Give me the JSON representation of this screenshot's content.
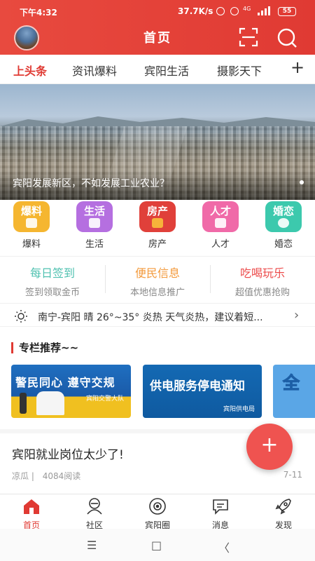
{
  "status": {
    "time": "下午4:32",
    "speed": "37.7K/s",
    "network": "4G",
    "battery": "55"
  },
  "header": {
    "title": "首页"
  },
  "tabs": [
    "上头条",
    "资讯爆料",
    "宾阳生活",
    "摄影天下"
  ],
  "tabs_more": "+",
  "banner": {
    "caption": "宾阳发展新区，不如发展工业农业？"
  },
  "categories": [
    {
      "tile": "爆料",
      "label": "爆料",
      "color": "#f5b630"
    },
    {
      "tile": "生活",
      "label": "生活",
      "color": "#b56fe0"
    },
    {
      "tile": "房产",
      "label": "房产",
      "color": "#e0403a"
    },
    {
      "tile": "人才",
      "label": "人才",
      "color": "#f06aa8"
    },
    {
      "tile": "婚恋",
      "label": "婚恋",
      "color": "#3cc9ad"
    }
  ],
  "services": [
    {
      "title": "每日签到",
      "sub": "签到领取金币",
      "color": "#4fc1b0"
    },
    {
      "title": "便民信息",
      "sub": "本地信息推广",
      "color": "#f39a3c"
    },
    {
      "title": "吃喝玩乐",
      "sub": "超值优惠抢购",
      "color": "#ec4b4b"
    }
  ],
  "weather": {
    "text": "南宁-宾阳 晴 26°~35° 炎热 天气炎热，建议着短..."
  },
  "columns": {
    "title": "专栏推荐~~",
    "cards": [
      {
        "big": "警民同心 遵守交规",
        "small": "宾阳交警大队"
      },
      {
        "big": "供电服务停电通知",
        "small": "宾阳供电局"
      },
      {
        "big": "全"
      }
    ]
  },
  "article": {
    "title": "宾阳就业岗位太少了!",
    "author": "凉瓜",
    "reads": "4084阅读",
    "date": "7-11"
  },
  "fab": "+",
  "bottom_nav": [
    {
      "label": "首页",
      "icon": "home-icon"
    },
    {
      "label": "社区",
      "icon": "community-icon"
    },
    {
      "label": "宾阳圈",
      "icon": "circle-icon"
    },
    {
      "label": "消息",
      "icon": "message-icon"
    },
    {
      "label": "发现",
      "icon": "rocket-icon"
    }
  ],
  "system_nav": {
    "menu": "☰",
    "home": "□",
    "back": "〈"
  },
  "colors": {
    "accent": "#e03a33",
    "fab": "#ef5350"
  }
}
